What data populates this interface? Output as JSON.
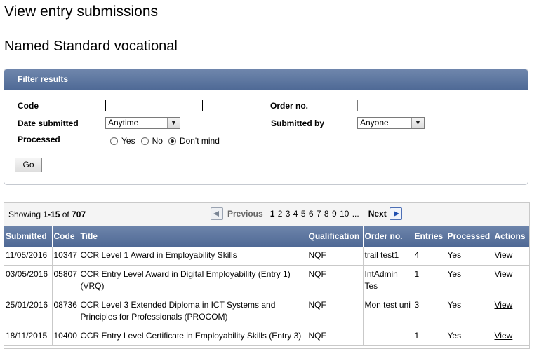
{
  "page": {
    "title": "View entry submissions",
    "subtitle": "Named Standard vocational"
  },
  "filter": {
    "header": "Filter results",
    "code_label": "Code",
    "code_value": "",
    "order_label": "Order no.",
    "order_value": "",
    "date_label": "Date submitted",
    "date_value": "Anytime",
    "submitted_by_label": "Submitted by",
    "submitted_by_value": "Anyone",
    "processed_label": "Processed",
    "processed_options": [
      "Yes",
      "No",
      "Don't mind"
    ],
    "processed_selected": "Don't mind",
    "go_label": "Go"
  },
  "results": {
    "showing_prefix": "Showing ",
    "showing_range": "1-15",
    "showing_of": " of ",
    "showing_total": "707",
    "previous_label": "Previous",
    "pages": [
      "1",
      "2",
      "3",
      "4",
      "5",
      "6",
      "7",
      "8",
      "9",
      "10",
      "..."
    ],
    "current_page": "1",
    "next_label": "Next"
  },
  "table": {
    "columns": [
      "Submitted",
      "Code",
      "Title",
      "Qualification",
      "Order no.",
      "Entries",
      "Processed",
      "Actions"
    ],
    "rows": [
      {
        "submitted": "11/05/2016",
        "code": "10347",
        "title": "OCR Level 1 Award in Employability Skills",
        "qualification": "NQF",
        "order_no": "trail test1",
        "entries": "4",
        "processed": "Yes",
        "action": "View"
      },
      {
        "submitted": "03/05/2016",
        "code": "05807",
        "title": "OCR Entry Level Award in Digital Employability (Entry 1) (VRQ)",
        "qualification": "NQF",
        "order_no": "IntAdmin Tes",
        "entries": "1",
        "processed": "Yes",
        "action": "View"
      },
      {
        "submitted": "25/01/2016",
        "code": "08736",
        "title": "OCR Level 3 Extended Diploma in ICT Systems and Principles for Professionals (PROCOM)",
        "qualification": "NQF",
        "order_no": "Mon test uni",
        "entries": "3",
        "processed": "Yes",
        "action": "View"
      },
      {
        "submitted": "18/11/2015",
        "code": "10400",
        "title": "OCR Entry Level Certificate in Employability Skills (Entry 3)",
        "qualification": "NQF",
        "order_no": "",
        "entries": "1",
        "processed": "Yes",
        "action": "View"
      }
    ]
  }
}
